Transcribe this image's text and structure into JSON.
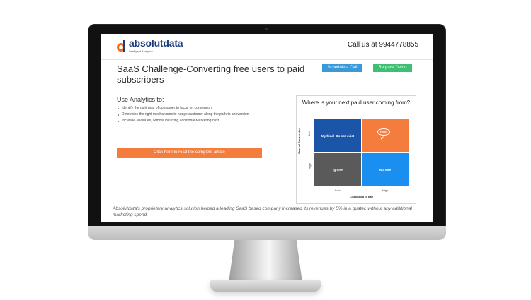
{
  "header": {
    "logo_name": "absolutdata",
    "logo_tagline": "Intelligent Analytics",
    "call_us": "Call us at 9944778855"
  },
  "main": {
    "title": "SaaS Challenge-Converting free users to paid subscribers",
    "schedule_label": "Schedule a Call",
    "demo_label": "Request Demo",
    "analytics_heading": "Use Analytics to:",
    "bullets": [
      "Identify the right pool of consumer to focus on conversion",
      "Determine the right mechanisms to nudge customer along the path-to-conversion",
      "Increase revenues, without incurring additional Marketing cost"
    ],
    "article_button": "Click here to read the complete article"
  },
  "matrix": {
    "title": "Where is your next paid user coming from?",
    "y_axis_title": "Cost of Conversion",
    "y_low": "Low",
    "y_high": "High",
    "x_axis_title": "Likelihood to pay",
    "x_low": "Low",
    "x_high": "High",
    "cells": {
      "top_left": "Mythical–Do not exist",
      "top_right": "Focus",
      "bottom_left": "Ignore",
      "bottom_right": "Nurture"
    },
    "colors": {
      "top_left": "#1a55a8",
      "top_right": "#f47c3c",
      "bottom_left": "#5a5a5a",
      "bottom_right": "#1a8ff0"
    }
  },
  "footer": {
    "note": "Absolutdata's proprietary analytics solution helped a leading SaaS based company increased its revenues by 5% in a quater, without any additional marketing spend."
  },
  "colors": {
    "brand_orange": "#f26a1b",
    "brand_navy": "#1d3d7c",
    "schedule_button": "#3a9ad9",
    "demo_button": "#3fbf73",
    "article_button": "#f47c3c"
  }
}
